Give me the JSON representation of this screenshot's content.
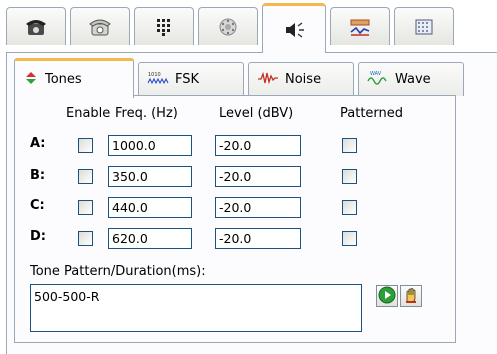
{
  "top_tabs": [
    {
      "icon": "telephone-icon"
    },
    {
      "icon": "rotary-phone-icon"
    },
    {
      "icon": "keypad-icon"
    },
    {
      "icon": "dial-icon"
    },
    {
      "icon": "speaker-icon",
      "active": true
    },
    {
      "icon": "signal-chart-icon"
    },
    {
      "icon": "grid-display-icon"
    }
  ],
  "sub_tabs": [
    {
      "label": "Tones",
      "icon": "tones-icon",
      "active": true
    },
    {
      "label": "FSK",
      "icon": "fsk-icon"
    },
    {
      "label": "Noise",
      "icon": "noise-icon"
    },
    {
      "label": "Wave",
      "icon": "wave-icon"
    }
  ],
  "headers": {
    "enable": "Enable",
    "freq": "Freq. (Hz)",
    "level": "Level (dBV)",
    "patterned": "Patterned"
  },
  "tones": [
    {
      "label": "A:",
      "enabled": false,
      "freq": "1000.0",
      "level": "-20.0",
      "patterned": false
    },
    {
      "label": "B:",
      "enabled": false,
      "freq": "350.0",
      "level": "-20.0",
      "patterned": false
    },
    {
      "label": "C:",
      "enabled": false,
      "freq": "440.0",
      "level": "-20.0",
      "patterned": false
    },
    {
      "label": "D:",
      "enabled": false,
      "freq": "620.0",
      "level": "-20.0",
      "patterned": false
    }
  ],
  "pattern": {
    "label": "Tone Pattern/Duration(ms):",
    "value": "500-500-R"
  },
  "colors": {
    "tab_accent": "#f5b84a",
    "border": "#9aa9b8",
    "field_border": "#1c5180",
    "play_green": "#2e9e3a"
  }
}
